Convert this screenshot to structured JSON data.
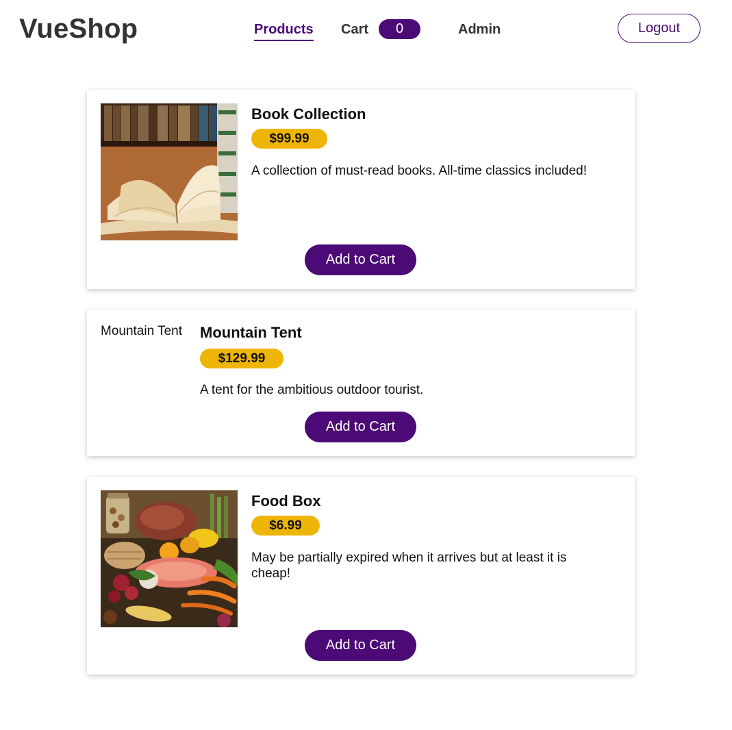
{
  "header": {
    "brand": "VueShop",
    "nav": {
      "products": "Products",
      "cart": "Cart",
      "cart_count": "0",
      "admin": "Admin"
    },
    "logout": "Logout"
  },
  "products": [
    {
      "title": "Book Collection",
      "price": "$99.99",
      "description": "A collection of must-read books. All-time classics included!",
      "button": "Add to Cart"
    },
    {
      "image_alt": "Mountain Tent",
      "title": "Mountain Tent",
      "price": "$129.99",
      "description": "A tent for the ambitious outdoor tourist.",
      "button": "Add to Cart"
    },
    {
      "title": "Food Box",
      "price": "$6.99",
      "description": "May be partially expired when it arrives but at least it is cheap!",
      "button": "Add to Cart"
    }
  ],
  "colors": {
    "accent": "#4b0a75",
    "price_badge": "#efb506",
    "brand_text": "#333333"
  }
}
